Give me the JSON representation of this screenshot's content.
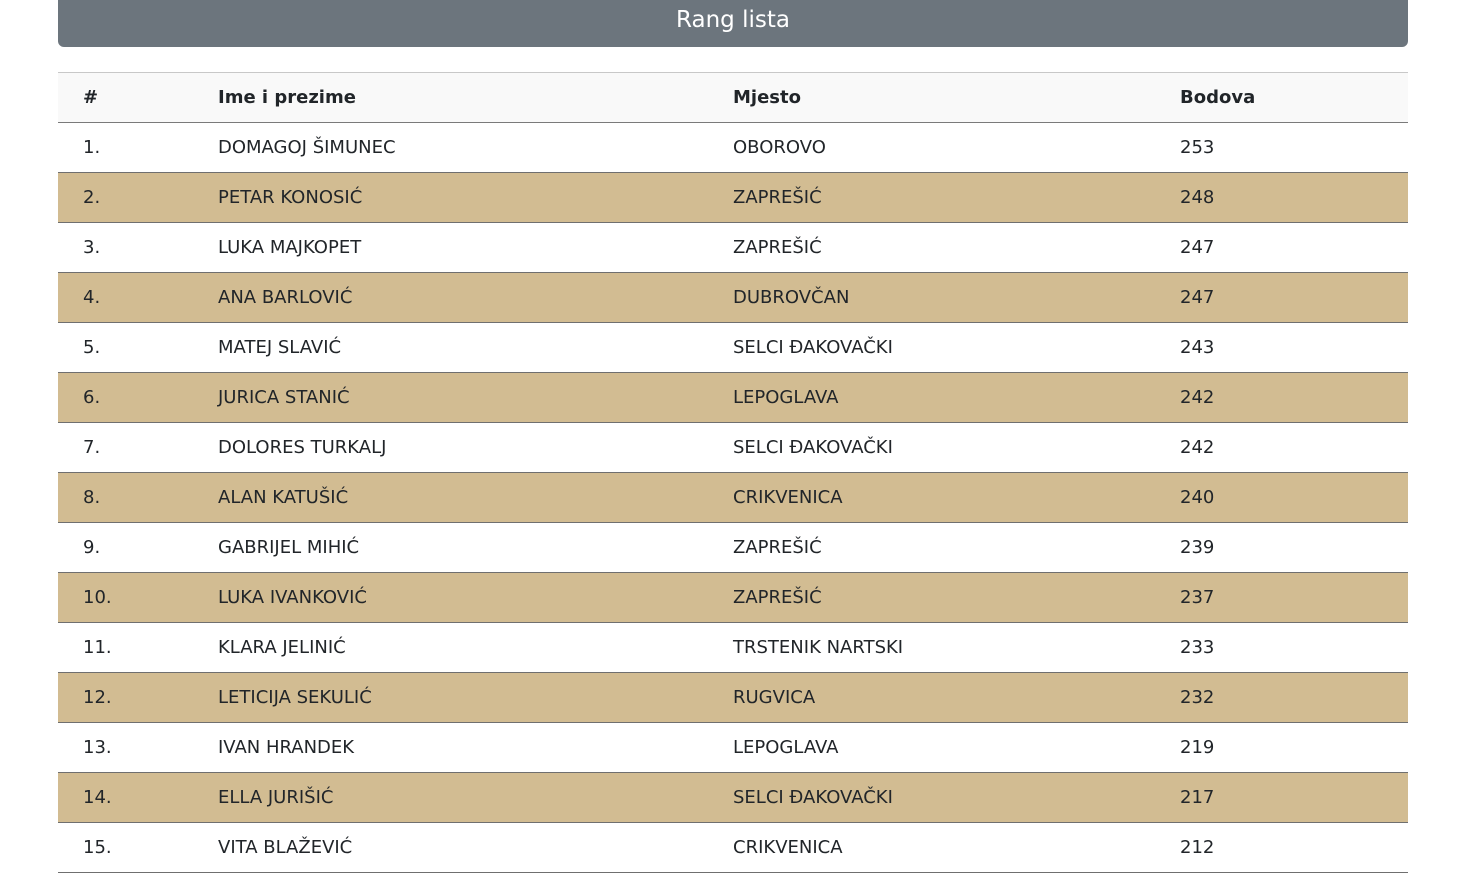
{
  "header": {
    "title": "Rang lista"
  },
  "table": {
    "columns": [
      "#",
      "Ime i prezime",
      "Mjesto",
      "Bodova"
    ],
    "rows": [
      {
        "rank": "1.",
        "name": "DOMAGOJ ŠIMUNEC",
        "place": "OBOROVO",
        "points": "253"
      },
      {
        "rank": "2.",
        "name": "PETAR KONOSIĆ",
        "place": "ZAPREŠIĆ",
        "points": "248"
      },
      {
        "rank": "3.",
        "name": "LUKA MAJKOPET",
        "place": "ZAPREŠIĆ",
        "points": "247"
      },
      {
        "rank": "4.",
        "name": "ANA BARLOVIĆ",
        "place": "DUBROVČAN",
        "points": "247"
      },
      {
        "rank": "5.",
        "name": "MATEJ SLAVIĆ",
        "place": "SELCI ĐAKOVAČKI",
        "points": "243"
      },
      {
        "rank": "6.",
        "name": "JURICA STANIĆ",
        "place": "LEPOGLAVA",
        "points": "242"
      },
      {
        "rank": "7.",
        "name": "DOLORES TURKALJ",
        "place": "SELCI ĐAKOVAČKI",
        "points": "242"
      },
      {
        "rank": "8.",
        "name": "ALAN KATUŠIĆ",
        "place": "CRIKVENICA",
        "points": "240"
      },
      {
        "rank": "9.",
        "name": "GABRIJEL MIHIĆ",
        "place": "ZAPREŠIĆ",
        "points": "239"
      },
      {
        "rank": "10.",
        "name": "LUKA IVANKOVIĆ",
        "place": "ZAPREŠIĆ",
        "points": "237"
      },
      {
        "rank": "11.",
        "name": "KLARA JELINIĆ",
        "place": "TRSTENIK NARTSKI",
        "points": "233"
      },
      {
        "rank": "12.",
        "name": "LETICIJA SEKULIĆ",
        "place": "RUGVICA",
        "points": "232"
      },
      {
        "rank": "13.",
        "name": "IVAN HRANDEK",
        "place": "LEPOGLAVA",
        "points": "219"
      },
      {
        "rank": "14.",
        "name": "ELLA JURIŠIĆ",
        "place": "SELCI ĐAKOVAČKI",
        "points": "217"
      },
      {
        "rank": "15.",
        "name": "VITA BLAŽEVIĆ",
        "place": "CRIKVENICA",
        "points": "212"
      }
    ]
  },
  "colors": {
    "title_bar": "#6c757d",
    "striped_row": "#d2bc92"
  }
}
